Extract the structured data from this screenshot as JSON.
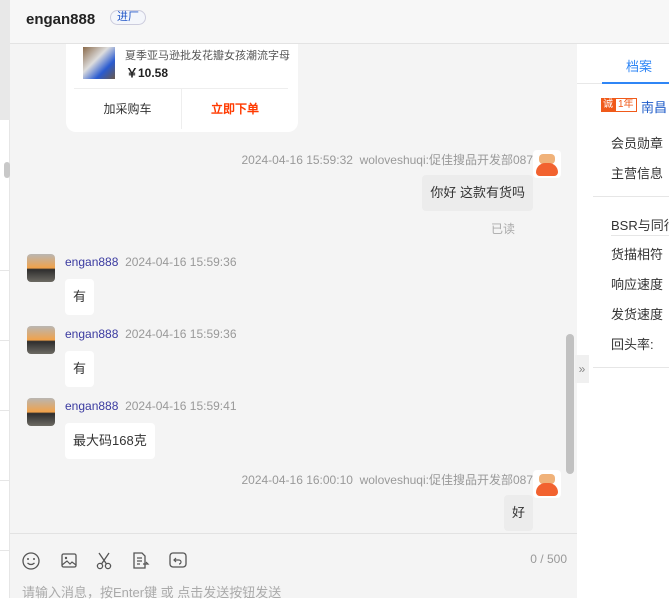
{
  "header": {
    "title": "engan888",
    "badge": "进厂"
  },
  "product": {
    "title": "夏季亚马逊批发花瓣女孩潮流字母",
    "price": "￥10.58",
    "add_cart": "加采购车",
    "buy_now": "立即下单"
  },
  "messages": [
    {
      "from": "me",
      "time": "2024-04-16 15:59:32",
      "sender": "woloveshuqi:促佳搜品开发部087",
      "text": "你好 这款有货吗",
      "status": "已读"
    },
    {
      "from": "other",
      "sender": "engan888",
      "time": "2024-04-16 15:59:36",
      "text": "有"
    },
    {
      "from": "other",
      "sender": "engan888",
      "time": "2024-04-16 15:59:36",
      "text": "有"
    },
    {
      "from": "other",
      "sender": "engan888",
      "time": "2024-04-16 15:59:41",
      "text": "最大码168克"
    },
    {
      "from": "me",
      "time": "2024-04-16 16:00:10",
      "sender": "woloveshuqi:促佳搜品开发部087",
      "text": "好"
    }
  ],
  "input": {
    "placeholder": "请输入消息，按Enter键 或 点击发送按钮发送",
    "count": "0 / 500",
    "tools": [
      "smile-icon",
      "image-icon",
      "scissors-icon",
      "file-icon",
      "history-icon"
    ]
  },
  "right": {
    "tab": "档案",
    "badge_a": "诚",
    "badge_b": "1年",
    "location": "南昌",
    "items1": [
      "会员勋章",
      "主营信息"
    ],
    "items2": [
      "BSR与同行",
      "货描相符",
      "响应速度",
      "发货速度",
      "回头率:"
    ]
  },
  "colors": {
    "accent": "#2f86f6",
    "buy": "#ff3a00"
  }
}
